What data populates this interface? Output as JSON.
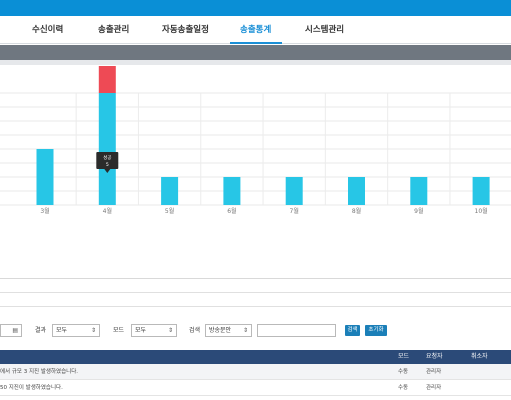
{
  "nav": {
    "tabs": [
      {
        "label": "수신이력",
        "active": false
      },
      {
        "label": "송출관리",
        "active": false
      },
      {
        "label": "자동송출일정",
        "active": false
      },
      {
        "label": "송출통계",
        "active": true
      },
      {
        "label": "시스템관리",
        "active": false
      }
    ]
  },
  "colors": {
    "accent": "#1a8fd6",
    "bar_success": "#27c6e6",
    "bar_fail": "#ee4a55",
    "table_header": "#2b4a78"
  },
  "chart_data": {
    "type": "bar",
    "stacked": true,
    "categories": [
      "3월",
      "4월",
      "5월",
      "6월",
      "7월",
      "8월",
      "9월",
      "10월"
    ],
    "series": [
      {
        "name": "성공",
        "values": [
          4,
          8,
          2,
          2,
          2,
          2,
          2,
          2
        ]
      },
      {
        "values": [
          0,
          2,
          0,
          0,
          0,
          0,
          0,
          0
        ]
      }
    ],
    "tooltip": {
      "title": "성공",
      "value": "5"
    },
    "grid": true,
    "legend": "none"
  },
  "filters": {
    "date_icon": "calendar-icon",
    "result_label": "결과",
    "result_value": "모두",
    "mode_label": "모드",
    "mode_value": "모두",
    "search_label": "검색",
    "search_field_value": "방송문안",
    "search_input_value": "",
    "search_button": "검색",
    "reset_button": "초기화"
  },
  "table": {
    "headers": {
      "mode": "모드",
      "requester": "요청자",
      "cancel": "취소자"
    },
    "rows": [
      {
        "message": "에서 규모 3 지진 발생하였습니다.",
        "mode": "수동",
        "requester": "관리자",
        "cancel": ""
      },
      {
        "message": "50 지진이 발생하였습니다.",
        "mode": "수동",
        "requester": "관리자",
        "cancel": ""
      }
    ]
  }
}
